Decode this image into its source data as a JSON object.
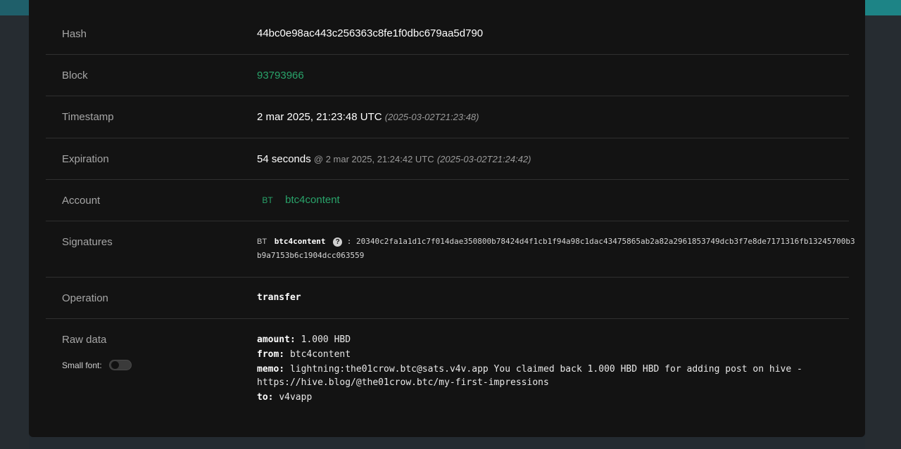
{
  "rows": {
    "hash": {
      "label": "Hash",
      "value": "44bc0e98ac443c256363c8fe1f0dbc679aa5d790"
    },
    "block": {
      "label": "Block",
      "value": "93793966"
    },
    "timestamp": {
      "label": "Timestamp",
      "value": "2 mar 2025, 21:23:48 UTC",
      "iso": "(2025-03-02T21:23:48)"
    },
    "expiration": {
      "label": "Expiration",
      "value": "54 seconds",
      "at": "@ 2 mar 2025, 21:24:42 UTC",
      "iso": "(2025-03-02T21:24:42)"
    },
    "account": {
      "label": "Account",
      "avatar": "BT",
      "value": "btc4content"
    },
    "signatures": {
      "label": "Signatures",
      "avatar": "BT",
      "account": "btc4content",
      "separator": ":",
      "line1": "20340c2fa1a1d1c7f014dae350800b78424d4f1cb1f94a98c1dac43475865ab2a82a2961853749dcb3f7e8de7171316fb13245700b3",
      "line2": "b9a7153b6c1904dcc063559"
    },
    "operation": {
      "label": "Operation",
      "value": "transfer"
    },
    "raw": {
      "label": "Raw data",
      "small_font_label": "Small font:",
      "amount_key": "amount:",
      "amount_val": "1.000 HBD",
      "from_key": "from:",
      "from_val": "btc4content",
      "memo_key": "memo:",
      "memo_val": "lightning:the01crow.btc@sats.v4v.app You claimed back 1.000 HBD HBD for adding post on hive -",
      "memo_val2": "https://hive.blog/@the01crow.btc/my-first-impressions",
      "to_key": "to:",
      "to_val": "v4vapp"
    }
  },
  "icons": {
    "help": "?"
  },
  "colors": {
    "accent": "#29a36a",
    "panel": "#131313",
    "background": "#242b31"
  }
}
